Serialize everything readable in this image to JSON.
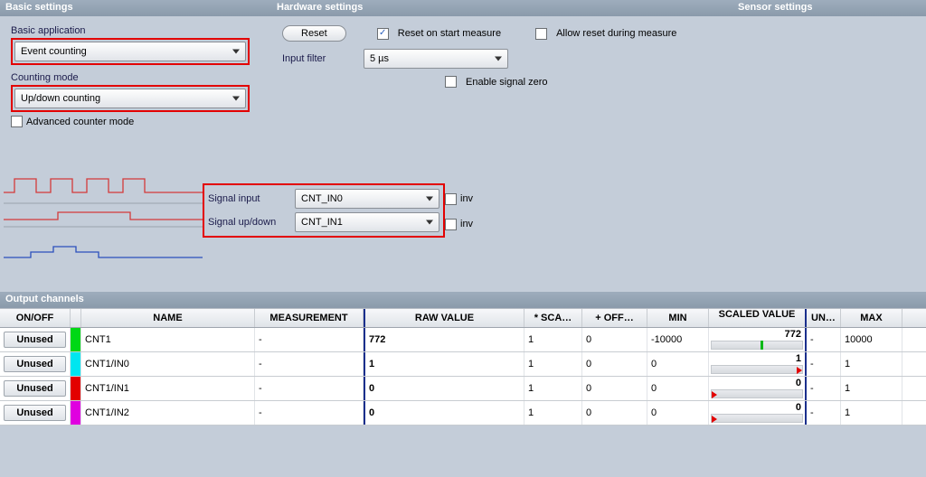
{
  "headers": {
    "basic": "Basic settings",
    "hardware": "Hardware settings",
    "sensor": "Sensor settings",
    "output": "Output channels"
  },
  "basic": {
    "app_label": "Basic application",
    "app_value": "Event counting",
    "mode_label": "Counting mode",
    "mode_value": "Up/down counting",
    "adv_label": "Advanced counter mode",
    "adv_checked": false
  },
  "hardware": {
    "reset_btn": "Reset",
    "reset_on_start": "Reset on start measure",
    "reset_on_start_checked": true,
    "allow_reset": "Allow reset during measure",
    "allow_reset_checked": false,
    "filter_label": "Input filter",
    "filter_value": "5 µs",
    "enable_zero": "Enable signal zero",
    "enable_zero_checked": false
  },
  "signal": {
    "input_label": "Signal input",
    "input_value": "CNT_IN0",
    "updown_label": "Signal up/down",
    "updown_value": "CNT_IN1",
    "inv_label": "inv"
  },
  "grid": {
    "cols": {
      "onoff": "ON/OFF",
      "name": "NAME",
      "meas": "MEASUREMENT",
      "raw": "RAW VALUE",
      "sca": "* SCA…",
      "off": "+ OFF…",
      "min": "MIN",
      "scaled": "SCALED VALUE",
      "un": "UN…",
      "max": "MAX"
    },
    "rows": [
      {
        "onoff": "Unused",
        "color": "#00d815",
        "name": "CNT1",
        "meas": "-",
        "raw": "772",
        "sca": "1",
        "off": "0",
        "min": "-10000",
        "scaled": "772",
        "tick_pct": 54,
        "arrow_pct": null,
        "un": "-",
        "max": "10000"
      },
      {
        "onoff": "Unused",
        "color": "#00e6f0",
        "name": "CNT1/IN0",
        "meas": "-",
        "raw": "1",
        "sca": "1",
        "off": "0",
        "min": "0",
        "scaled": "1",
        "tick_pct": null,
        "arrow_pct": 94,
        "un": "-",
        "max": "1"
      },
      {
        "onoff": "Unused",
        "color": "#e30000",
        "name": "CNT1/IN1",
        "meas": "-",
        "raw": "0",
        "sca": "1",
        "off": "0",
        "min": "0",
        "scaled": "0",
        "tick_pct": null,
        "arrow_pct": 0,
        "un": "-",
        "max": "1"
      },
      {
        "onoff": "Unused",
        "color": "#e000e0",
        "name": "CNT1/IN2",
        "meas": "-",
        "raw": "0",
        "sca": "1",
        "off": "0",
        "min": "0",
        "scaled": "0",
        "tick_pct": null,
        "arrow_pct": 0,
        "un": "-",
        "max": "1"
      }
    ]
  }
}
